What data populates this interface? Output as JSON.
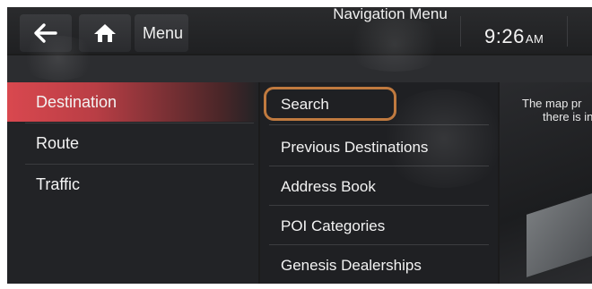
{
  "header": {
    "menu_label": "Menu",
    "time": "9:26",
    "ampm": "AM"
  },
  "title": "Navigation Menu",
  "left_menu": [
    {
      "label": "Destination",
      "active": true
    },
    {
      "label": "Route",
      "active": false
    },
    {
      "label": "Traffic",
      "active": false
    }
  ],
  "list_items": [
    {
      "label": "Search",
      "highlighted": true
    },
    {
      "label": "Previous Destinations"
    },
    {
      "label": "Address Book"
    },
    {
      "label": "POI Categories"
    },
    {
      "label": "Genesis Dealerships"
    }
  ],
  "map_message": {
    "line1": "The map pr",
    "line2": "there is in"
  },
  "colors": {
    "active_accent": "#d9484f",
    "highlight_ring": "#c07a3f",
    "background": "#1b1b1c"
  },
  "icons": {
    "back": "back-arrow-icon",
    "home": "home-icon"
  }
}
